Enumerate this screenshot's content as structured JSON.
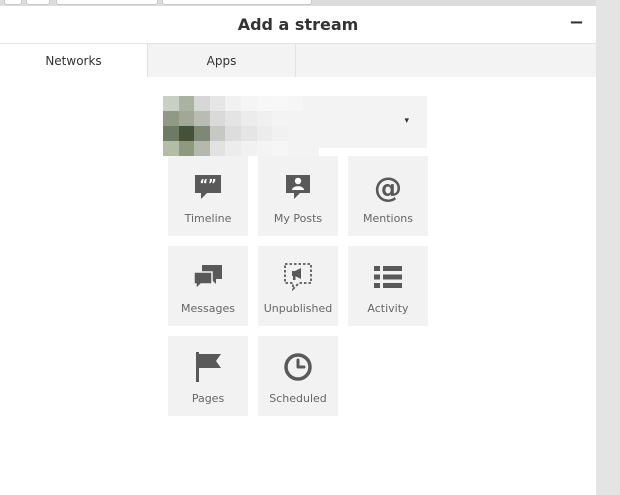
{
  "header": {
    "title": "Add a stream",
    "minimize_label": "−"
  },
  "tabs": [
    {
      "label": "Networks",
      "active": true
    },
    {
      "label": "Apps",
      "active": false
    }
  ],
  "account_selector": {
    "avatar": "blurred-avatar",
    "arrow": "▾"
  },
  "streams": [
    {
      "label": "Timeline",
      "icon": "quote-bubble-icon"
    },
    {
      "label": "My Posts",
      "icon": "user-post-icon"
    },
    {
      "label": "Mentions",
      "icon": "at-sign-icon"
    },
    {
      "label": "Messages",
      "icon": "chat-bubbles-icon"
    },
    {
      "label": "Unpublished",
      "icon": "megaphone-dashed-icon"
    },
    {
      "label": "Activity",
      "icon": "list-icon"
    },
    {
      "label": "Pages",
      "icon": "flag-icon"
    },
    {
      "label": "Scheduled",
      "icon": "clock-icon"
    }
  ],
  "colors": {
    "icon": "#595959",
    "tile_bg": "#f2f2f2",
    "title": "#333333"
  }
}
